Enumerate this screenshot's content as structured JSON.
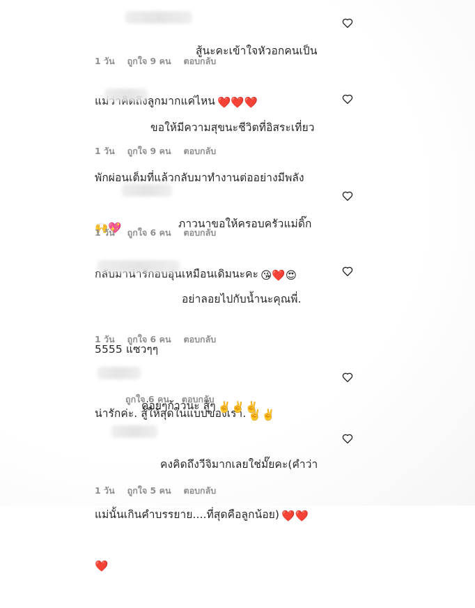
{
  "comments": [
    {
      "line1": "สู้นะคะเข้าใจหัวอกคนเป็น",
      "line2": "แม่ว่าคิดถึงลูกมากแค่ไหน",
      "emoji_tail": "❤️❤️❤️",
      "time": "1 วัน",
      "likes": "ถูกใจ 9 คน",
      "reply": "ตอบกลับ"
    },
    {
      "line1": "ขอให้มีความสุขนะชีวิตที่อิสระเที่ยว",
      "line2": "พักผ่อนเต็มที่แล้วกลับมาทำงานต่ออย่างมีพลัง",
      "line3": "🙌💖",
      "time": "1 วัน",
      "likes": "ถูกใจ 9 คน",
      "reply": "ตอบกลับ"
    },
    {
      "line1": "ภาวนาขอให้ครอบครัวแม่ดิ๊ก",
      "line2": "กลับมาน่ารักอบอุ่นเหมือนเดิมนะคะ",
      "emoji_tail": "😘❤️😍",
      "time": "1 วัน",
      "likes": "ถูกใจ 6 คน",
      "reply": "ตอบกลับ"
    },
    {
      "line1": "อย่าลอยไปกับน้ำนะคุณพี่.",
      "line2": "5555 แซวๆๆ",
      "line3": "น่ารักค่ะ. สู้ให้สุดในแบบของเรา.",
      "emoji_tail": "✌️✌️",
      "time": "1 วัน",
      "likes": "ถูกใจ 6 คน",
      "reply": "ตอบกลับ"
    },
    {
      "line1": "ค่อยๆก้าวนะ สู้ๆ",
      "emoji_tail": "✌️✌️✌️",
      "likes": "ถูกใจ 6 คน",
      "reply": "ตอบกลับ"
    },
    {
      "line1": "คงคิดถึงวีจิมากเลยใช่มั๊ยคะ(คำว่า",
      "line2": "แม่นั้นเกินคำบรรยาย....ที่สุดคือลูกน้อย)",
      "emoji_tail": "❤️❤️",
      "line3": "❤️",
      "time": "1 วัน",
      "likes": "ถูกใจ 5 คน",
      "reply": "ตอบกลับ"
    }
  ],
  "icons": {
    "like": "heart-outline-icon"
  },
  "colors": {
    "text": "#262626",
    "meta": "#8e8e8e",
    "heart_emoji": "#e0162b"
  }
}
